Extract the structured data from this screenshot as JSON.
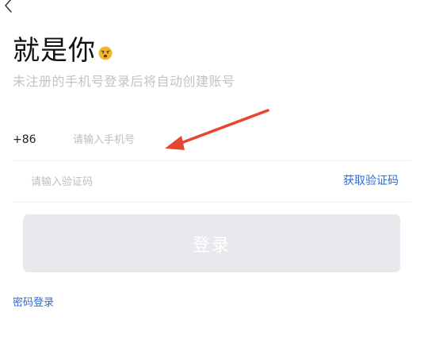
{
  "header": {
    "back_icon": "chevron-left-icon",
    "title": "就是你",
    "emoji_icon": "smiley-emoji-icon",
    "subtitle": "未注册的手机号登录后将自动创建账号"
  },
  "phone": {
    "country_code": "+86",
    "placeholder": "请输入手机号",
    "value": ""
  },
  "code": {
    "placeholder": "请输入验证码",
    "value": "",
    "get_code_label": "获取验证码"
  },
  "login": {
    "label": "登录"
  },
  "password_login_label": "密码登录",
  "annotation": {
    "arrow_icon": "red-arrow-icon",
    "color": "#e8452f"
  },
  "colors": {
    "link": "#2f6bd6",
    "button_disabled_bg": "#e8e8ed",
    "placeholder": "#bdbdc2",
    "subtitle": "#c3c3c7"
  }
}
